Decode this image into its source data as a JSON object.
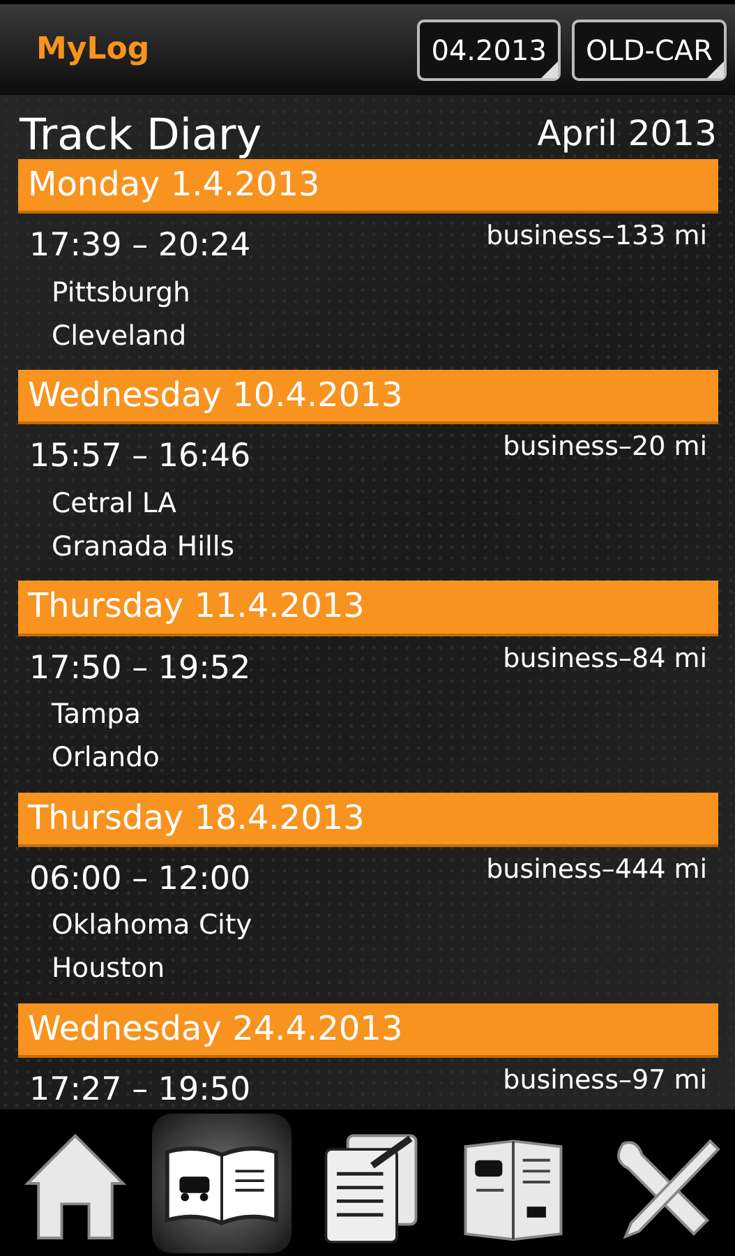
{
  "app_bar": {
    "title": "MyLog",
    "buttons": [
      "04.2013",
      "OLD-CAR"
    ]
  },
  "header": {
    "title": "Track Diary",
    "period": "April 2013"
  },
  "days": [
    {
      "date": "Monday 1.4.2013",
      "trips": [
        {
          "time": "17:39  – 20:24",
          "summary": "business–133 mi",
          "from": "Pittsburgh",
          "to": "Cleveland"
        }
      ]
    },
    {
      "date": "Wednesday 10.4.2013",
      "trips": [
        {
          "time": "15:57  – 16:46",
          "summary": "business–20 mi",
          "from": "Cetral LA",
          "to": "Granada Hills"
        }
      ]
    },
    {
      "date": "Thursday 11.4.2013",
      "trips": [
        {
          "time": "17:50  – 19:52",
          "summary": "business–84 mi",
          "from": "Tampa",
          "to": "Orlando"
        }
      ]
    },
    {
      "date": "Thursday 18.4.2013",
      "trips": [
        {
          "time": "06:00  – 12:00",
          "summary": "business–444 mi",
          "from": "Oklahoma City",
          "to": "Houston"
        }
      ]
    },
    {
      "date": "Wednesday 24.4.2013",
      "trips": [
        {
          "time": "17:27  – 19:50",
          "summary": "business–97 mi"
        }
      ]
    }
  ],
  "toolbar": [
    {
      "kind": "home",
      "selected": false
    },
    {
      "kind": "diary",
      "selected": true
    },
    {
      "kind": "edit",
      "selected": false
    },
    {
      "kind": "report",
      "selected": false
    },
    {
      "kind": "tools",
      "selected": false
    }
  ]
}
